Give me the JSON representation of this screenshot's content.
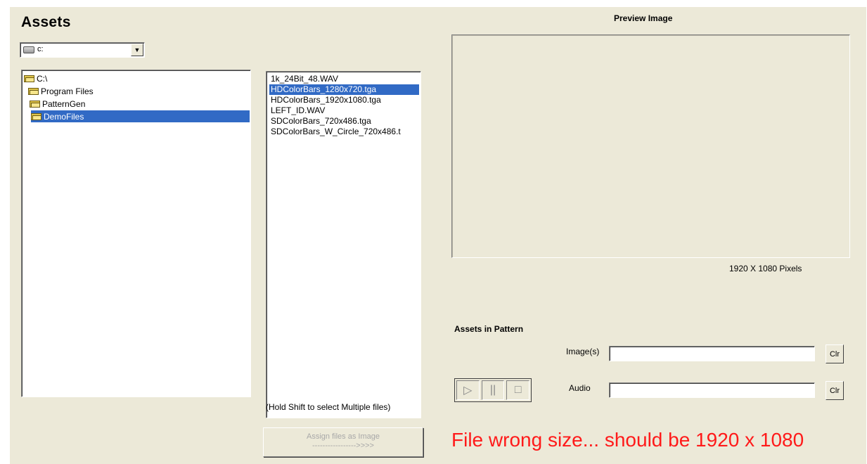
{
  "assets": {
    "title": "Assets",
    "drive": {
      "icon": "drive-icon",
      "value": "c:",
      "arrow": "▼"
    },
    "folders": [
      {
        "label": "C:\\",
        "selected": false
      },
      {
        "label": "Program Files",
        "selected": false
      },
      {
        "label": "PatternGen",
        "selected": false
      },
      {
        "label": "DemoFiles",
        "selected": true
      }
    ],
    "files": [
      {
        "label": "1k_24Bit_48.WAV",
        "selected": false
      },
      {
        "label": "HDColorBars_1280x720.tga",
        "selected": true
      },
      {
        "label": "HDColorBars_1920x1080.tga",
        "selected": false
      },
      {
        "label": "LEFT_ID.WAV",
        "selected": false
      },
      {
        "label": "SDColorBars_720x486.tga",
        "selected": false
      },
      {
        "label": "SDColorBars_W_Circle_720x486.t",
        "selected": false
      }
    ],
    "hint": "(Hold Shift to select Multiple files)",
    "assign_button": {
      "line1": "Assign files as Image",
      "line2": "----------------->>>>"
    }
  },
  "preview": {
    "title": "Preview Image",
    "size_text": "1920 X  1080 Pixels"
  },
  "pattern": {
    "title": "Assets in Pattern",
    "image_label": "Image(s)",
    "image_value": "",
    "audio_label": "Audio",
    "audio_value": "",
    "clear_label": "Clr",
    "transport": {
      "play": "▷",
      "pause": "||",
      "stop": "□"
    }
  },
  "error": {
    "message": "File wrong size... should be 1920 x 1080",
    "color": "#ff1a1a"
  },
  "colors": {
    "selection": "#316ac5",
    "panel": "#ece9d8"
  }
}
